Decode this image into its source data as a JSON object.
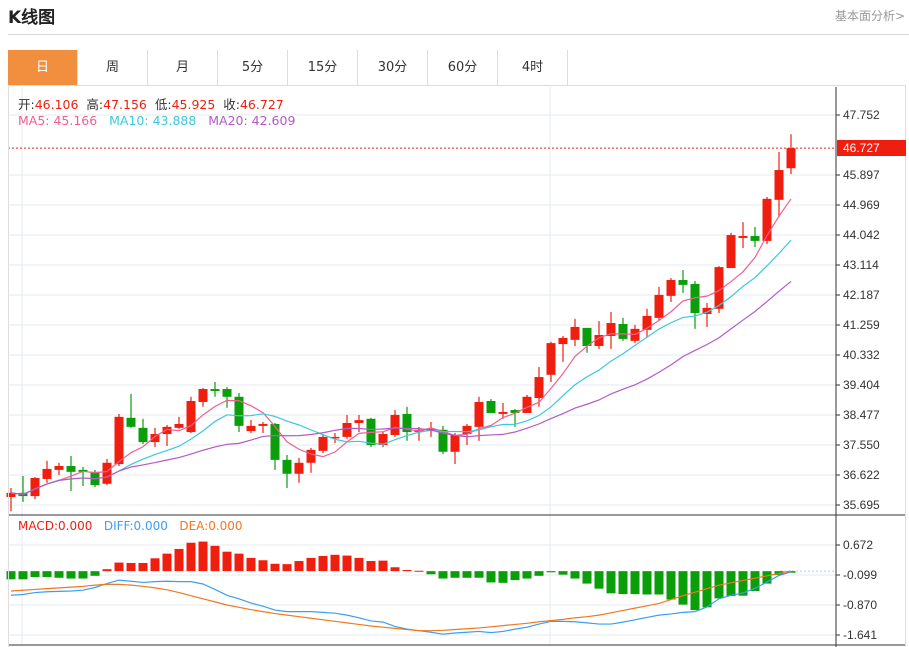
{
  "header": {
    "title": "K线图",
    "link": "基本面分析>"
  },
  "tabs": [
    {
      "label": "日",
      "active": true
    },
    {
      "label": "周"
    },
    {
      "label": "月"
    },
    {
      "label": "5分"
    },
    {
      "label": "15分"
    },
    {
      "label": "30分"
    },
    {
      "label": "60分"
    },
    {
      "label": "4时"
    }
  ],
  "ohlc_legend": {
    "open_label": "开:",
    "open": "46.106",
    "high_label": "高:",
    "high": "47.156",
    "low_label": "低:",
    "low": "45.925",
    "close_label": "收:",
    "close": "46.727"
  },
  "ma_legend": {
    "ma5": "MA5: 45.166",
    "ma10": "MA10: 43.888",
    "ma20": "MA20: 42.609"
  },
  "macd_legend": {
    "macd": "MACD:0.000",
    "diff": "DIFF:0.000",
    "dea": "DEA:0.000"
  },
  "current_price": "46.727",
  "colors": {
    "up": "#f01e0e",
    "down": "#0a9e0a",
    "ma5": "#f0608f",
    "ma10": "#3cc8dc",
    "ma20": "#b45ac8",
    "diff": "#3b9ff0",
    "dea": "#f07820",
    "accent": "#f28f3f"
  },
  "chart_data": [
    {
      "type": "candlestick",
      "title": "K线图",
      "ylim": [
        35.695,
        47.752
      ],
      "y_ticks": [
        "47.752",
        "45.897",
        "44.969",
        "44.042",
        "43.114",
        "42.187",
        "41.259",
        "40.332",
        "39.404",
        "38.477",
        "37.550",
        "36.622",
        "35.695"
      ],
      "ohlc": [
        [
          35.94,
          36.22,
          35.5,
          36.07
        ],
        [
          36.07,
          36.59,
          35.79,
          35.97
        ],
        [
          35.97,
          36.56,
          35.88,
          36.53
        ],
        [
          36.5,
          37.06,
          36.38,
          36.81
        ],
        [
          36.78,
          37.0,
          36.62,
          36.9
        ],
        [
          36.9,
          37.21,
          36.13,
          36.72
        ],
        [
          36.78,
          36.87,
          36.28,
          36.72
        ],
        [
          36.72,
          36.78,
          36.25,
          36.31
        ],
        [
          36.35,
          37.12,
          36.31,
          37.0
        ],
        [
          36.96,
          38.51,
          36.9,
          38.42
        ],
        [
          38.39,
          39.13,
          38.08,
          38.11
        ],
        [
          38.08,
          38.36,
          37.58,
          37.64
        ],
        [
          37.64,
          38.08,
          37.49,
          37.89
        ],
        [
          37.89,
          38.17,
          37.52,
          38.11
        ],
        [
          38.08,
          38.42,
          38.05,
          38.2
        ],
        [
          37.95,
          39.04,
          37.92,
          38.91
        ],
        [
          38.88,
          39.31,
          38.73,
          39.28
        ],
        [
          39.28,
          39.5,
          39.04,
          39.22
        ],
        [
          39.28,
          39.34,
          38.7,
          39.04
        ],
        [
          39.04,
          39.16,
          37.95,
          38.14
        ],
        [
          37.98,
          38.32,
          37.92,
          38.14
        ],
        [
          38.14,
          38.26,
          37.92,
          38.2
        ],
        [
          38.2,
          38.23,
          36.78,
          37.09
        ],
        [
          37.09,
          37.24,
          36.22,
          36.66
        ],
        [
          36.66,
          37.15,
          36.38,
          37.0
        ],
        [
          37.0,
          37.46,
          36.69,
          37.4
        ],
        [
          37.37,
          37.86,
          37.3,
          37.8
        ],
        [
          37.77,
          37.92,
          37.61,
          37.8
        ],
        [
          37.8,
          38.48,
          37.74,
          38.23
        ],
        [
          38.23,
          38.48,
          37.95,
          38.32
        ],
        [
          38.36,
          38.39,
          37.49,
          37.55
        ],
        [
          37.55,
          37.95,
          37.49,
          37.89
        ],
        [
          37.86,
          38.63,
          37.8,
          38.48
        ],
        [
          38.51,
          38.73,
          37.68,
          37.95
        ],
        [
          37.95,
          38.11,
          37.68,
          38.02
        ],
        [
          37.98,
          38.26,
          37.8,
          38.05
        ],
        [
          38.02,
          38.14,
          37.27,
          37.34
        ],
        [
          37.34,
          37.92,
          36.96,
          37.86
        ],
        [
          37.89,
          38.2,
          37.55,
          38.14
        ],
        [
          38.11,
          39.04,
          37.68,
          38.88
        ],
        [
          38.91,
          38.97,
          38.54,
          38.54
        ],
        [
          38.51,
          38.85,
          38.36,
          38.57
        ],
        [
          38.63,
          38.66,
          38.11,
          38.54
        ],
        [
          38.54,
          39.1,
          38.54,
          39.04
        ],
        [
          39.0,
          39.96,
          38.73,
          39.65
        ],
        [
          39.72,
          40.74,
          39.5,
          40.7
        ],
        [
          40.67,
          40.92,
          40.12,
          40.86
        ],
        [
          40.8,
          41.45,
          40.61,
          41.2
        ],
        [
          41.17,
          41.17,
          40.4,
          40.61
        ],
        [
          40.61,
          41.38,
          40.52,
          40.95
        ],
        [
          40.92,
          41.66,
          40.52,
          41.32
        ],
        [
          41.29,
          41.48,
          40.77,
          40.83
        ],
        [
          40.77,
          41.26,
          40.7,
          41.14
        ],
        [
          41.11,
          41.76,
          40.89,
          41.54
        ],
        [
          41.48,
          42.44,
          41.38,
          42.19
        ],
        [
          42.16,
          42.71,
          41.97,
          42.65
        ],
        [
          42.65,
          42.96,
          42.25,
          42.5
        ],
        [
          42.53,
          42.62,
          41.14,
          41.63
        ],
        [
          41.6,
          41.94,
          41.2,
          41.79
        ],
        [
          41.76,
          43.08,
          41.63,
          43.05
        ],
        [
          43.02,
          44.11,
          43.02,
          44.04
        ],
        [
          43.95,
          44.44,
          43.64,
          44.01
        ],
        [
          44.01,
          44.29,
          43.67,
          43.86
        ],
        [
          43.86,
          45.22,
          43.76,
          45.16
        ],
        [
          45.13,
          46.61,
          44.6,
          46.05
        ],
        [
          46.106,
          47.156,
          45.925,
          46.727
        ]
      ],
      "ma_periods": [
        5,
        10,
        20
      ]
    },
    {
      "type": "macd",
      "y_ticks": [
        "0.672",
        "-0.099",
        "-0.870",
        "-1.641"
      ],
      "ylim": [
        -1.641,
        0.672
      ],
      "macd": [
        -0.21,
        -0.21,
        -0.15,
        -0.15,
        -0.17,
        -0.19,
        -0.19,
        -0.12,
        0.05,
        0.22,
        0.21,
        0.21,
        0.33,
        0.45,
        0.57,
        0.73,
        0.76,
        0.65,
        0.5,
        0.45,
        0.34,
        0.28,
        0.19,
        0.18,
        0.26,
        0.34,
        0.39,
        0.42,
        0.4,
        0.34,
        0.26,
        0.27,
        0.1,
        0.03,
        0.01,
        -0.08,
        -0.19,
        -0.17,
        -0.17,
        -0.17,
        -0.29,
        -0.3,
        -0.23,
        -0.19,
        -0.12,
        -0.03,
        -0.09,
        -0.19,
        -0.32,
        -0.45,
        -0.57,
        -0.59,
        -0.59,
        -0.6,
        -0.6,
        -0.73,
        -0.86,
        -1.0,
        -0.93,
        -0.7,
        -0.64,
        -0.63,
        -0.51,
        -0.32,
        -0.1,
        -0.04
      ],
      "dea": [
        -0.51,
        -0.49,
        -0.47,
        -0.45,
        -0.43,
        -0.41,
        -0.39,
        -0.36,
        -0.34,
        -0.34,
        -0.36,
        -0.39,
        -0.43,
        -0.48,
        -0.55,
        -0.63,
        -0.71,
        -0.79,
        -0.87,
        -0.93,
        -0.99,
        -1.04,
        -1.09,
        -1.13,
        -1.17,
        -1.21,
        -1.25,
        -1.29,
        -1.33,
        -1.37,
        -1.41,
        -1.44,
        -1.47,
        -1.5,
        -1.53,
        -1.53,
        -1.52,
        -1.5,
        -1.48,
        -1.46,
        -1.43,
        -1.4,
        -1.37,
        -1.34,
        -1.3,
        -1.27,
        -1.24,
        -1.2,
        -1.17,
        -1.13,
        -1.07,
        -1.01,
        -0.95,
        -0.89,
        -0.83,
        -0.73,
        -0.63,
        -0.54,
        -0.45,
        -0.36,
        -0.3,
        -0.24,
        -0.18,
        -0.12,
        -0.06,
        0.0
      ],
      "diff": [
        -0.62,
        -0.6,
        -0.55,
        -0.53,
        -0.52,
        -0.51,
        -0.49,
        -0.42,
        -0.32,
        -0.23,
        -0.26,
        -0.29,
        -0.27,
        -0.26,
        -0.27,
        -0.27,
        -0.33,
        -0.47,
        -0.62,
        -0.71,
        -0.82,
        -0.9,
        -1.0,
        -1.04,
        -1.04,
        -1.04,
        -1.06,
        -1.08,
        -1.13,
        -1.2,
        -1.28,
        -1.31,
        -1.42,
        -1.49,
        -1.53,
        -1.57,
        -1.62,
        -1.59,
        -1.57,
        -1.55,
        -1.58,
        -1.55,
        -1.49,
        -1.44,
        -1.36,
        -1.29,
        -1.29,
        -1.3,
        -1.33,
        -1.36,
        -1.36,
        -1.31,
        -1.25,
        -1.19,
        -1.13,
        -1.1,
        -1.06,
        -1.04,
        -0.92,
        -0.71,
        -0.62,
        -0.56,
        -0.44,
        -0.28,
        -0.11,
        -0.02
      ]
    }
  ]
}
